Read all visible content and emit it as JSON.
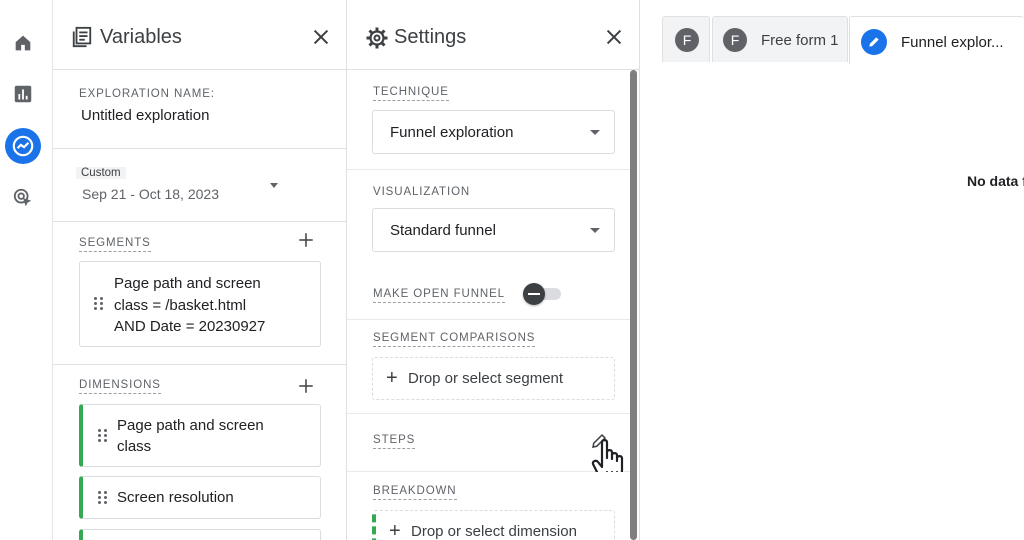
{
  "nav": {
    "items": [
      {
        "name": "home",
        "icon": "home-icon"
      },
      {
        "name": "reports",
        "icon": "bar-chart-icon"
      },
      {
        "name": "explore",
        "icon": "explore-icon",
        "active": true
      },
      {
        "name": "advertising",
        "icon": "cursor-target-icon"
      }
    ]
  },
  "variables": {
    "title": "Variables",
    "exploration_name_label": "EXPLORATION NAME:",
    "exploration_name": "Untitled exploration",
    "date_range_label": "Custom",
    "date_range": "Sep 21 - Oct 18, 2023",
    "segments_label": "SEGMENTS",
    "segments": [
      {
        "line1": "Page path and screen",
        "line2": "class = /basket.html",
        "line3": "AND Date = 20230927"
      }
    ],
    "dimensions_label": "DIMENSIONS",
    "dimensions": [
      {
        "line1": "Page path and screen",
        "line2": "class"
      },
      {
        "line1": "Screen resolution"
      }
    ]
  },
  "settings": {
    "title": "Settings",
    "technique_label": "TECHNIQUE",
    "technique_value": "Funnel exploration",
    "visualization_label": "VISUALIZATION",
    "visualization_value": "Standard funnel",
    "open_funnel_label": "MAKE OPEN FUNNEL",
    "open_funnel_on": false,
    "segment_comparisons_label": "SEGMENT COMPARISONS",
    "segment_drop": "Drop or select segment",
    "steps_label": "STEPS",
    "breakdown_label": "BREAKDOWN",
    "dimension_drop": "Drop or select dimension"
  },
  "tabs": [
    {
      "avatar": "F",
      "label": ""
    },
    {
      "avatar": "F",
      "label": "Free form 1"
    },
    {
      "avatar": "pencil",
      "label": "Funnel explor..."
    }
  ],
  "canvas": {
    "no_data": "No data f"
  },
  "colors": {
    "accent": "#1a73e8",
    "dimension_bar": "#34a853"
  }
}
